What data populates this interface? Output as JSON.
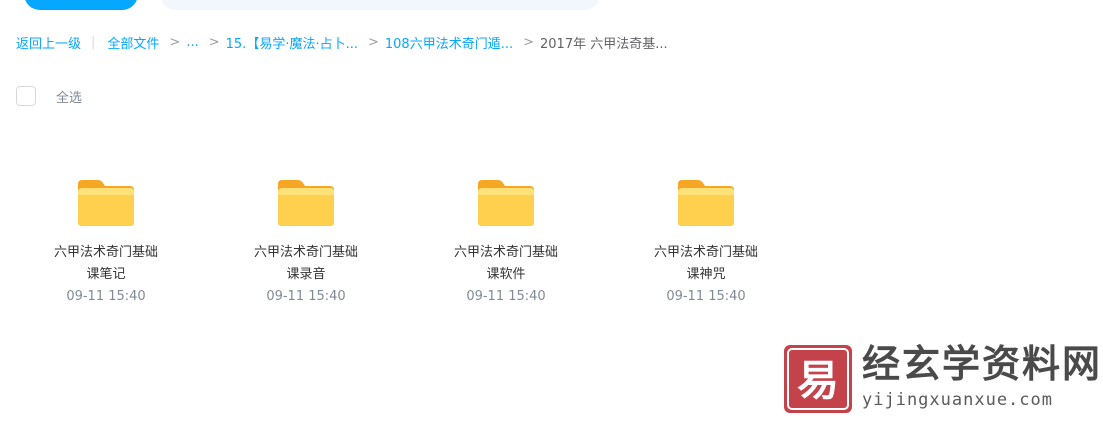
{
  "breadcrumb": {
    "back": "返回上一级",
    "all_files": "全部文件",
    "ellipsis": "...",
    "level1": "15.【易学·魔法·占卜...",
    "level2": "108六甲法术奇门遁...",
    "current": "2017年 六甲法奇基...",
    "separator": ">",
    "divider": "|"
  },
  "toolbar": {
    "select_all": "全选"
  },
  "files": [
    {
      "name_line1": "六甲法术奇门基础",
      "name_line2": "课笔记",
      "time": "09-11 15:40",
      "type": "folder"
    },
    {
      "name_line1": "六甲法术奇门基础",
      "name_line2": "课录音",
      "time": "09-11 15:40",
      "type": "folder"
    },
    {
      "name_line1": "六甲法术奇门基础",
      "name_line2": "课软件",
      "time": "09-11 15:40",
      "type": "folder"
    },
    {
      "name_line1": "六甲法术奇门基础",
      "name_line2": "课神咒",
      "time": "09-11 15:40",
      "type": "folder"
    }
  ],
  "watermark": {
    "title": "经玄学资料网",
    "url": "yijingxuanxue.com",
    "badge_char": "易"
  },
  "colors": {
    "accent": "#06a7ff",
    "folder": "#ffc53d",
    "watermark_red": "#c4424a"
  }
}
